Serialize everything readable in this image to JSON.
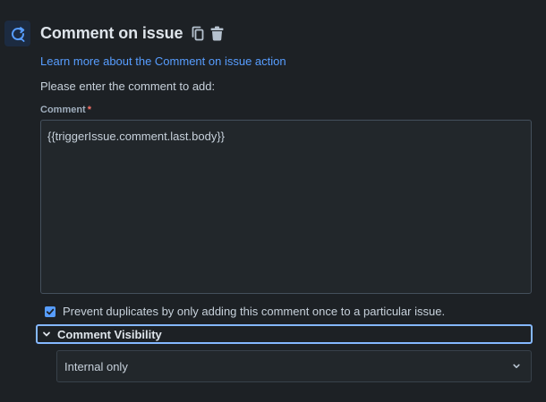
{
  "action": {
    "title": "Comment on issue",
    "icon": "refresh-comment-icon",
    "accent": "#579dff",
    "learn_more": "Learn more about the Comment on issue action",
    "instruction": "Please enter the comment to add:"
  },
  "comment_field": {
    "label": "Comment",
    "required_mark": "*",
    "value": "{{triggerIssue.comment.last.body}}"
  },
  "prevent_duplicates": {
    "label": "Prevent duplicates by only adding this comment once to a particular issue.",
    "checked": true
  },
  "visibility": {
    "section_title": "Comment Visibility",
    "expanded": true,
    "selected": "Internal only"
  }
}
